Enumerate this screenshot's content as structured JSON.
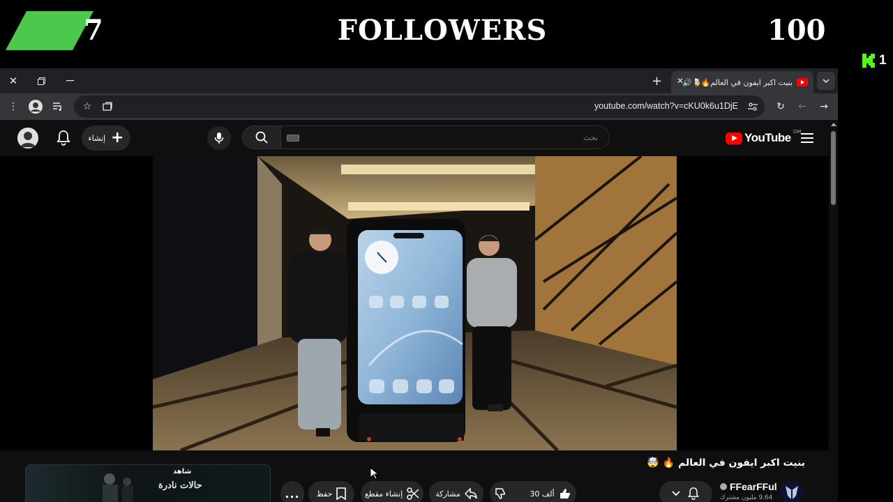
{
  "overlay": {
    "left_count": "7",
    "title": "FOLLOWERS",
    "right_count": "100",
    "kick_count": "1",
    "accent_green": "#4cc84c"
  },
  "browser": {
    "tab": {
      "title": "بنيت اكبر ايفون في العالم🔥🤯",
      "favicon": "youtube-favicon-icon"
    },
    "url": "youtube.com/watch?v=cKU0k6u1DjE"
  },
  "youtube": {
    "logo_text": "YouTube",
    "logo_country": "OM",
    "search_placeholder": "بحث",
    "create_label": "إنشاء",
    "video": {
      "title": "بنيت اكبر ايفون في العالم 🔥 🤯",
      "channel_name": "FFearFFul",
      "subscribers": "9.64 مليون مشترك",
      "likes": "30 ألف",
      "share_label": "مشاركة",
      "clip_label": "إنشاء مقطع",
      "save_label": "حفظ",
      "more_label": "..."
    },
    "ad": {
      "brand": "شاهد",
      "show_title": "حالات نادرة"
    }
  }
}
